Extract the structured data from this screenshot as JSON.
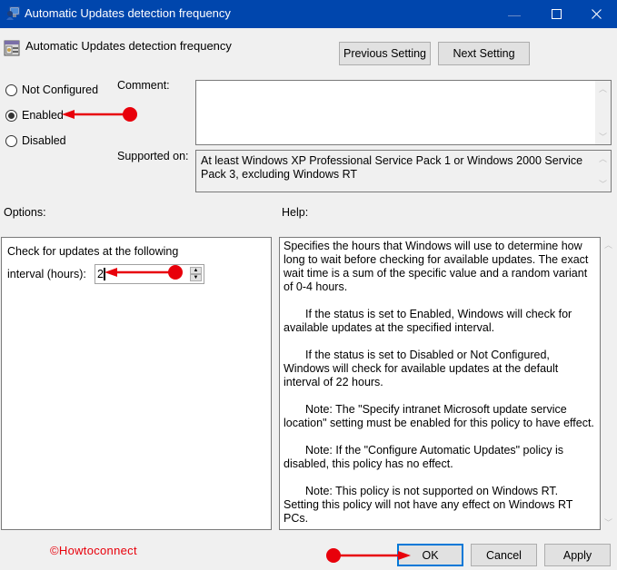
{
  "window": {
    "title": "Automatic Updates detection frequency",
    "controls": {
      "minimize_icon": "minimize-icon",
      "maximize_icon": "maximize-icon",
      "close_icon": "close-icon",
      "minimize_glyph": "—",
      "maximize_glyph": "☐",
      "close_glyph": "✕"
    }
  },
  "header": {
    "policy_title": "Automatic Updates detection frequency",
    "previous_label": "Previous Setting",
    "next_label": "Next Setting"
  },
  "state": {
    "options": [
      {
        "label": "Not Configured",
        "selected": false
      },
      {
        "label": "Enabled",
        "selected": true
      },
      {
        "label": "Disabled",
        "selected": false
      }
    ]
  },
  "comment": {
    "label": "Comment:",
    "value": ""
  },
  "supported_on": {
    "label": "Supported on:",
    "value": "At least Windows XP Professional Service Pack 1 or Windows 2000 Service Pack 3, excluding Windows RT"
  },
  "options_section": {
    "label": "Options:",
    "line1": "Check for updates at the following",
    "line2": "interval (hours):",
    "interval_value": "2",
    "spin_up": "▲",
    "spin_down": "▼"
  },
  "help_section": {
    "label": "Help:",
    "paragraphs": [
      "Specifies the hours that Windows will use to determine how long to wait before checking for available updates. The exact wait time is a sum of the specific value and a random variant of 0-4 hours.",
      "If the status is set to Enabled, Windows will check for available updates at the specified interval.",
      "If the status is set to Disabled or Not Configured, Windows will check for available updates at the default interval of 22 hours.",
      "Note: The \"Specify intranet Microsoft update service location\" setting must be enabled for this policy to have effect.",
      "Note: If the \"Configure Automatic Updates\" policy is disabled, this policy has no effect.",
      "Note: This policy is not supported on Windows RT. Setting this policy will not have any effect on Windows RT PCs."
    ]
  },
  "scroll": {
    "up_glyph": "︿",
    "down_glyph": "﹀"
  },
  "footer": {
    "watermark": "©Howtoconnect",
    "ok_label": "OK",
    "cancel_label": "Cancel",
    "apply_label": "Apply"
  },
  "colors": {
    "titlebar": "#0046ad",
    "annotation": "#e8000b",
    "focus": "#0078d7"
  }
}
